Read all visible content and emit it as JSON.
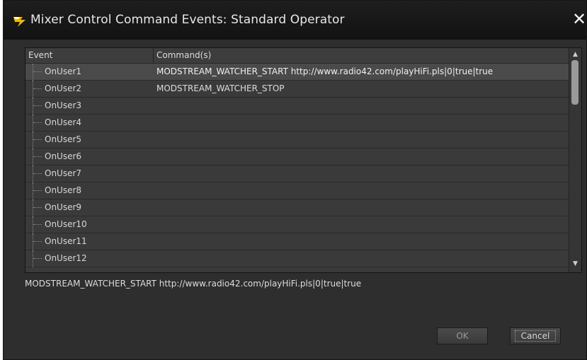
{
  "window": {
    "title": "Mixer Control Command Events: Standard Operator",
    "icon": "lightning-brush-icon",
    "close_glyph": "✕"
  },
  "grid": {
    "columns": [
      "Event",
      "Command(s)"
    ],
    "rows": [
      {
        "event": "OnUser1",
        "command": "MODSTREAM_WATCHER_START http://www.radio42.com/playHiFi.pls|0|true|true",
        "selected": true
      },
      {
        "event": "OnUser2",
        "command": "MODSTREAM_WATCHER_STOP"
      },
      {
        "event": "OnUser3",
        "command": ""
      },
      {
        "event": "OnUser4",
        "command": ""
      },
      {
        "event": "OnUser5",
        "command": ""
      },
      {
        "event": "OnUser6",
        "command": ""
      },
      {
        "event": "OnUser7",
        "command": ""
      },
      {
        "event": "OnUser8",
        "command": ""
      },
      {
        "event": "OnUser9",
        "command": ""
      },
      {
        "event": "OnUser10",
        "command": ""
      },
      {
        "event": "OnUser11",
        "command": ""
      },
      {
        "event": "OnUser12",
        "command": ""
      }
    ],
    "scroll_up_glyph": "▲",
    "scroll_down_glyph": "▼"
  },
  "status": {
    "text": "MODSTREAM_WATCHER_START http://www.radio42.com/playHiFi.pls|0|true|true"
  },
  "buttons": {
    "ok_label": "OK",
    "cancel_label": "Cancel"
  },
  "colors": {
    "background": "#2e2e2e",
    "titlebar": "#141414",
    "selected_row": "#4a4a4a",
    "icon_accent": "#f2b700"
  }
}
